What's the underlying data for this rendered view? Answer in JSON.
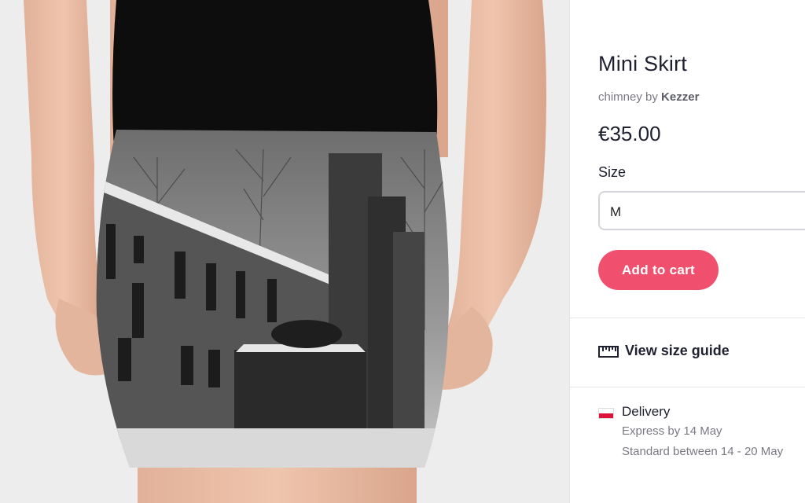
{
  "product": {
    "title": "Mini Skirt",
    "byline_prefix": "chimney by",
    "artist": "Kezzer",
    "price": "€35.00"
  },
  "size": {
    "label": "Size",
    "selected": "M"
  },
  "actions": {
    "add_to_cart": "Add to cart",
    "size_guide": "View size guide"
  },
  "delivery": {
    "title": "Delivery",
    "express": "Express by 14 May",
    "standard": "Standard between 14 - 20 May",
    "flag_colors": [
      "#ffffff",
      "#dc143c"
    ]
  },
  "colors": {
    "accent": "#f0506e",
    "text": "#1f2030",
    "muted": "#7a7a84"
  },
  "icons": {
    "size_guide": "ruler-icon",
    "delivery": "poland-flag-icon"
  }
}
